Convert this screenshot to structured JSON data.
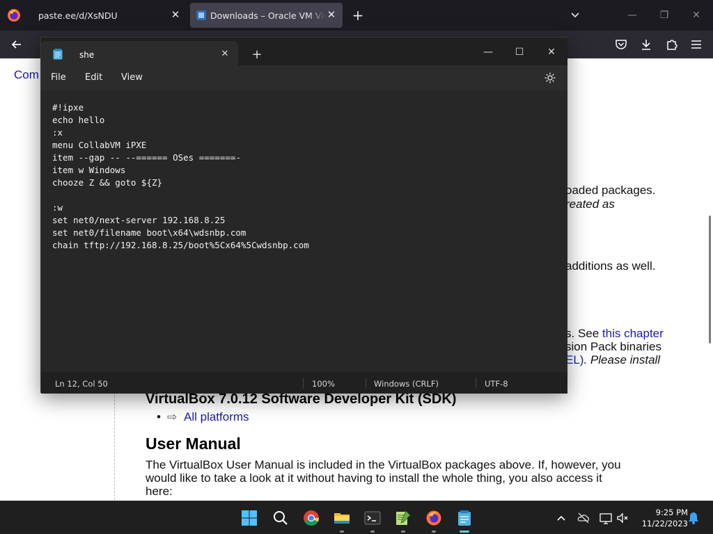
{
  "browser": {
    "tabs": [
      {
        "title": "paste.ee/d/XsNDU"
      },
      {
        "title": "Downloads – Oracle VM VirtualBox"
      }
    ]
  },
  "page": {
    "left_link": "Com",
    "frag1": "oaded packages.",
    "frag2": "reated as",
    "frag3": "additions as well.",
    "frag4_pre": "s. See ",
    "frag4_link": "this chapter",
    "frag5": "sion Pack binaries",
    "frag6_link": "EL)",
    "frag6_text": ". Please install",
    "sdk_heading": "VirtualBox 7.0.12 Software Developer Kit (SDK)",
    "sdk_arrow": "⇨",
    "sdk_link": "All platforms",
    "manual_heading": "User Manual",
    "manual_line1": "The VirtualBox User Manual is included in the VirtualBox packages above. If, however, you",
    "manual_line2": "would like to take a look at it without having to install the whole thing, you also access it",
    "manual_line3": "here:"
  },
  "notepad": {
    "tab_title": "she",
    "menu": {
      "file": "File",
      "edit": "Edit",
      "view": "View"
    },
    "content": "#!ipxe\necho hello\n:x\nmenu CollabVM iPXE\nitem --gap -- --====== OSes =======-\nitem w Windows\nchooze Z && goto ${Z}\n\n:w\nset net0/next-server 192.168.8.25\nset net0/filename boot\\x64\\wdsnbp.com\nchain tftp://192.168.8.25/boot%5Cx64%5Cwdsnbp.com",
    "status": {
      "position": "Ln 12, Col 50",
      "zoom": "100%",
      "line_ending": "Windows (CRLF)",
      "encoding": "UTF-8"
    }
  },
  "taskbar": {
    "time": "9:25 PM",
    "date": "11/22/2023"
  },
  "colors": {
    "firefox_tabstrip": "#1c1b22",
    "firefox_active_tab": "#42414d",
    "notepad_bg": "#202020",
    "link": "#1b1bb5",
    "taskbar_active": "#60cdff"
  }
}
